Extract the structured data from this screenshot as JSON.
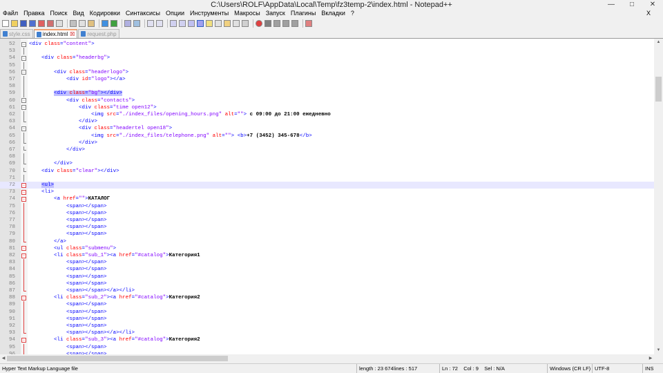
{
  "window": {
    "title": "C:\\Users\\ROLF\\AppData\\Local\\Temp\\fz3temp-2\\index.html - Notepad++",
    "controls": [
      "minimize-icon",
      "maximize-icon",
      "close-icon"
    ]
  },
  "menu": {
    "items": [
      "Файл",
      "Правка",
      "Поиск",
      "Вид",
      "Кодировки",
      "Синтаксисы",
      "Опции",
      "Инструменты",
      "Макросы",
      "Запуск",
      "Плагины",
      "Вкладки",
      "?"
    ],
    "close_label": "X"
  },
  "tabs": [
    {
      "label": "style.css",
      "active": false
    },
    {
      "label": "index.html",
      "active": true
    },
    {
      "label": "request.php",
      "active": false
    }
  ],
  "editor": {
    "current_line": 72,
    "lines": [
      {
        "n": "52",
        "f": "box",
        "t": [
          [
            "tag",
            "<div "
          ],
          [
            "attr",
            "class"
          ],
          [
            "tag",
            "="
          ],
          [
            "str",
            "\"content\""
          ],
          [
            "tag",
            ">"
          ]
        ]
      },
      {
        "n": "53",
        "f": "vl",
        "t": []
      },
      {
        "n": "54",
        "f": "box",
        "t": [
          [
            "",
            "    "
          ],
          [
            "tag",
            "<div "
          ],
          [
            "attr",
            "class"
          ],
          [
            "tag",
            "="
          ],
          [
            "str",
            "\"headerbg\""
          ],
          [
            "tag",
            ">"
          ]
        ]
      },
      {
        "n": "55",
        "f": "vl",
        "t": []
      },
      {
        "n": "56",
        "f": "box",
        "t": [
          [
            "",
            "        "
          ],
          [
            "tag",
            "<div "
          ],
          [
            "attr",
            "class"
          ],
          [
            "tag",
            "="
          ],
          [
            "str",
            "\"headerlogo\""
          ],
          [
            "tag",
            ">"
          ]
        ]
      },
      {
        "n": "57",
        "f": "vl",
        "t": [
          [
            "",
            "            "
          ],
          [
            "tag",
            "<div "
          ],
          [
            "attr",
            "id"
          ],
          [
            "tag",
            "="
          ],
          [
            "str",
            "\"logo\""
          ],
          [
            "tag",
            "></a>"
          ]
        ]
      },
      {
        "n": "58",
        "f": "vl",
        "t": []
      },
      {
        "n": "59",
        "f": "vl",
        "hl": true,
        "t": [
          [
            "",
            "        "
          ],
          [
            "tag",
            "<div "
          ],
          [
            "attr",
            "class"
          ],
          [
            "tag",
            "="
          ],
          [
            "str",
            "\"bg\""
          ],
          [
            "tag",
            "></div>"
          ]
        ]
      },
      {
        "n": "60",
        "f": "box",
        "t": [
          [
            "",
            "            "
          ],
          [
            "tag",
            "<div "
          ],
          [
            "attr",
            "class"
          ],
          [
            "tag",
            "="
          ],
          [
            "str",
            "\"contacts\""
          ],
          [
            "tag",
            ">"
          ]
        ]
      },
      {
        "n": "61",
        "f": "box",
        "t": [
          [
            "",
            "                "
          ],
          [
            "tag",
            "<div "
          ],
          [
            "attr",
            "class"
          ],
          [
            "tag",
            "="
          ],
          [
            "str",
            "\"time open12\""
          ],
          [
            "tag",
            ">"
          ]
        ]
      },
      {
        "n": "62",
        "f": "vl",
        "t": [
          [
            "",
            "                    "
          ],
          [
            "tag",
            "<img "
          ],
          [
            "attr",
            "src"
          ],
          [
            "tag",
            "="
          ],
          [
            "str",
            "\"./index_files/opening_hours.png\""
          ],
          [
            "tag",
            " "
          ],
          [
            "attr",
            "alt"
          ],
          [
            "tag",
            "="
          ],
          [
            "str",
            "\"\""
          ],
          [
            "tag",
            "> "
          ],
          [
            "txt",
            "с 09:00 до 21:00 ежедневно"
          ]
        ]
      },
      {
        "n": "63",
        "f": "end",
        "t": [
          [
            "",
            "                "
          ],
          [
            "tag",
            "</div>"
          ]
        ]
      },
      {
        "n": "64",
        "f": "box",
        "t": [
          [
            "",
            "                "
          ],
          [
            "tag",
            "<div "
          ],
          [
            "attr",
            "class"
          ],
          [
            "tag",
            "="
          ],
          [
            "str",
            "\"headertel open18\""
          ],
          [
            "tag",
            ">"
          ]
        ]
      },
      {
        "n": "65",
        "f": "vl",
        "t": [
          [
            "",
            "                    "
          ],
          [
            "tag",
            "<img "
          ],
          [
            "attr",
            "src"
          ],
          [
            "tag",
            "="
          ],
          [
            "str",
            "\"./index_files/telephone.png\""
          ],
          [
            "tag",
            " "
          ],
          [
            "attr",
            "alt"
          ],
          [
            "tag",
            "="
          ],
          [
            "str",
            "\"\""
          ],
          [
            "tag",
            "> <b>"
          ],
          [
            "txt",
            "+7 (3452) 345-678"
          ],
          [
            "tag",
            "</b>"
          ]
        ]
      },
      {
        "n": "66",
        "f": "end",
        "t": [
          [
            "",
            "                "
          ],
          [
            "tag",
            "</div>"
          ]
        ]
      },
      {
        "n": "67",
        "f": "end",
        "t": [
          [
            "",
            "            "
          ],
          [
            "tag",
            "</div>"
          ]
        ]
      },
      {
        "n": "68",
        "f": "vl",
        "t": []
      },
      {
        "n": "69",
        "f": "end",
        "t": [
          [
            "",
            "        "
          ],
          [
            "tag",
            "</div>"
          ]
        ]
      },
      {
        "n": "70",
        "f": "end",
        "t": [
          [
            "",
            "    "
          ],
          [
            "tag",
            "<div "
          ],
          [
            "attr",
            "class"
          ],
          [
            "tag",
            "="
          ],
          [
            "str",
            "\"clear\""
          ],
          [
            "tag",
            "></div>"
          ]
        ]
      },
      {
        "n": "71",
        "f": "vl",
        "t": []
      },
      {
        "n": "72",
        "f": "boxred",
        "cur": true,
        "t": [
          [
            "",
            "    "
          ],
          [
            "hltag",
            "<ul>"
          ]
        ]
      },
      {
        "n": "73",
        "f": "boxred",
        "t": [
          [
            "",
            "    "
          ],
          [
            "tag",
            "<li>"
          ]
        ]
      },
      {
        "n": "74",
        "f": "boxred",
        "t": [
          [
            "",
            "        "
          ],
          [
            "tag",
            "<a "
          ],
          [
            "attr",
            "href"
          ],
          [
            "tag",
            "="
          ],
          [
            "str",
            "\"\""
          ],
          [
            "tag",
            ">"
          ],
          [
            "txt",
            "КАТАЛОГ"
          ]
        ]
      },
      {
        "n": "75",
        "f": "vlred",
        "t": [
          [
            "",
            "            "
          ],
          [
            "tag",
            "<span></span>"
          ]
        ]
      },
      {
        "n": "76",
        "f": "vlred",
        "t": [
          [
            "",
            "            "
          ],
          [
            "tag",
            "<span></span>"
          ]
        ]
      },
      {
        "n": "77",
        "f": "vlred",
        "t": [
          [
            "",
            "            "
          ],
          [
            "tag",
            "<span></span>"
          ]
        ]
      },
      {
        "n": "78",
        "f": "vlred",
        "t": [
          [
            "",
            "            "
          ],
          [
            "tag",
            "<span></span>"
          ]
        ]
      },
      {
        "n": "79",
        "f": "vlred",
        "t": [
          [
            "",
            "            "
          ],
          [
            "tag",
            "<span></span>"
          ]
        ]
      },
      {
        "n": "80",
        "f": "endred",
        "t": [
          [
            "",
            "        "
          ],
          [
            "tag",
            "</a>"
          ]
        ]
      },
      {
        "n": "81",
        "f": "boxred",
        "t": [
          [
            "",
            "        "
          ],
          [
            "tag",
            "<ul "
          ],
          [
            "attr",
            "class"
          ],
          [
            "tag",
            "="
          ],
          [
            "str",
            "\"submenu\""
          ],
          [
            "tag",
            ">"
          ]
        ]
      },
      {
        "n": "82",
        "f": "boxred",
        "t": [
          [
            "",
            "        "
          ],
          [
            "tag",
            "<li "
          ],
          [
            "attr",
            "class"
          ],
          [
            "tag",
            "="
          ],
          [
            "str",
            "\"sub_1\""
          ],
          [
            "tag",
            "><a "
          ],
          [
            "attr",
            "href"
          ],
          [
            "tag",
            "="
          ],
          [
            "str",
            "\"#catalog\""
          ],
          [
            "tag",
            ">"
          ],
          [
            "txt",
            "Категория1"
          ]
        ]
      },
      {
        "n": "83",
        "f": "vlred",
        "t": [
          [
            "",
            "            "
          ],
          [
            "tag",
            "<span></span>"
          ]
        ]
      },
      {
        "n": "84",
        "f": "vlred",
        "t": [
          [
            "",
            "            "
          ],
          [
            "tag",
            "<span></span>"
          ]
        ]
      },
      {
        "n": "85",
        "f": "vlred",
        "t": [
          [
            "",
            "            "
          ],
          [
            "tag",
            "<span></span>"
          ]
        ]
      },
      {
        "n": "86",
        "f": "vlred",
        "t": [
          [
            "",
            "            "
          ],
          [
            "tag",
            "<span></span>"
          ]
        ]
      },
      {
        "n": "87",
        "f": "endred",
        "t": [
          [
            "",
            "            "
          ],
          [
            "tag",
            "<span></span></a></li>"
          ]
        ]
      },
      {
        "n": "88",
        "f": "boxred",
        "t": [
          [
            "",
            "        "
          ],
          [
            "tag",
            "<li "
          ],
          [
            "attr",
            "class"
          ],
          [
            "tag",
            "="
          ],
          [
            "str",
            "\"sub_2\""
          ],
          [
            "tag",
            "><a "
          ],
          [
            "attr",
            "href"
          ],
          [
            "tag",
            "="
          ],
          [
            "str",
            "\"#catalog\""
          ],
          [
            "tag",
            ">"
          ],
          [
            "txt",
            "Категория2"
          ]
        ]
      },
      {
        "n": "89",
        "f": "vlred",
        "t": [
          [
            "",
            "            "
          ],
          [
            "tag",
            "<span></span>"
          ]
        ]
      },
      {
        "n": "90",
        "f": "vlred",
        "t": [
          [
            "",
            "            "
          ],
          [
            "tag",
            "<span></span>"
          ]
        ]
      },
      {
        "n": "91",
        "f": "vlred",
        "t": [
          [
            "",
            "            "
          ],
          [
            "tag",
            "<span></span>"
          ]
        ]
      },
      {
        "n": "92",
        "f": "vlred",
        "t": [
          [
            "",
            "            "
          ],
          [
            "tag",
            "<span></span>"
          ]
        ]
      },
      {
        "n": "93",
        "f": "endred",
        "t": [
          [
            "",
            "            "
          ],
          [
            "tag",
            "<span></span></a></li>"
          ]
        ]
      },
      {
        "n": "94",
        "f": "boxred",
        "t": [
          [
            "",
            "        "
          ],
          [
            "tag",
            "<li "
          ],
          [
            "attr",
            "class"
          ],
          [
            "tag",
            "="
          ],
          [
            "str",
            "\"sub_3\""
          ],
          [
            "tag",
            "><a "
          ],
          [
            "attr",
            "href"
          ],
          [
            "tag",
            "="
          ],
          [
            "str",
            "\"#catalog\""
          ],
          [
            "tag",
            ">"
          ],
          [
            "txt",
            "Категория2"
          ]
        ]
      },
      {
        "n": "95",
        "f": "vlred",
        "t": [
          [
            "",
            "            "
          ],
          [
            "tag",
            "<span></span>"
          ]
        ]
      },
      {
        "n": "96",
        "f": "vlred",
        "t": [
          [
            "",
            "            "
          ],
          [
            "tag",
            "<span></span>"
          ]
        ]
      }
    ]
  },
  "status": {
    "file_type": "Hyper Text Markup Language file",
    "length": "length : 23 674",
    "lines": "lines : 517",
    "position": "Ln : 72    Col : 9    Sel : N/A",
    "eol": "Windows (CR LF)",
    "encoding": "UTF-8",
    "mode": "INS"
  }
}
